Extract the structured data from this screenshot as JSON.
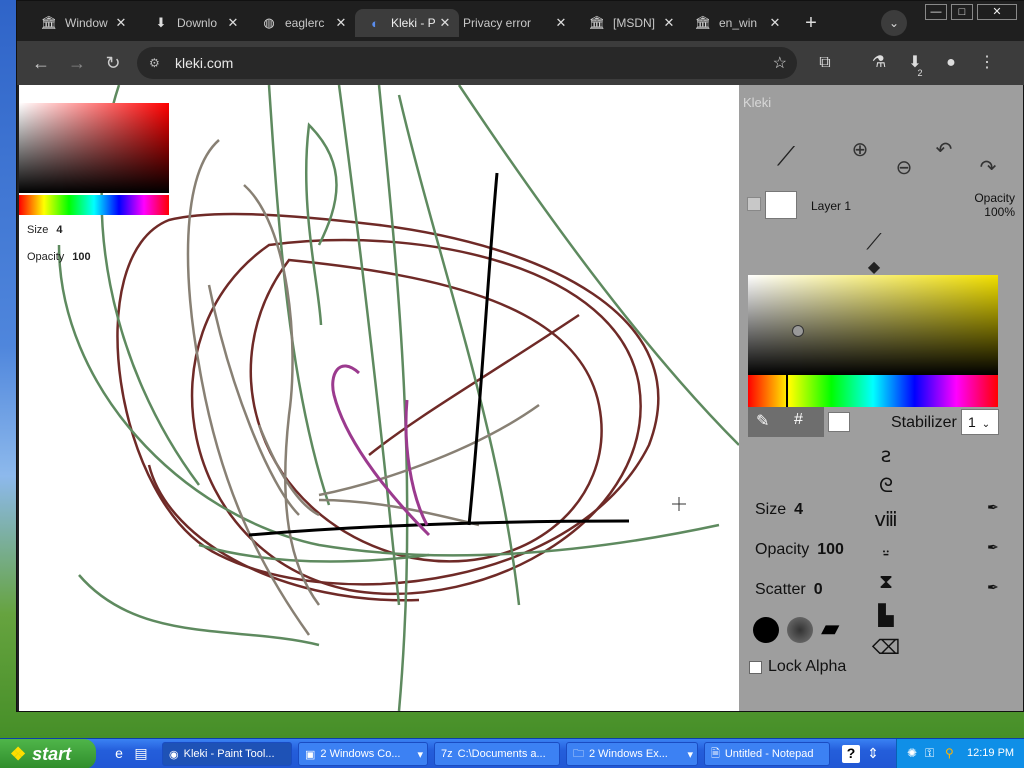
{
  "browser": {
    "tabs": [
      {
        "icon": "bank-icon",
        "glyph": "🏛",
        "label": "Window"
      },
      {
        "icon": "download-icon",
        "glyph": "⬇",
        "label": "Downlo"
      },
      {
        "icon": "globe-icon",
        "glyph": "◍",
        "label": "eaglerc"
      },
      {
        "icon": "kleki-icon",
        "glyph": "◐",
        "label": "Kleki - P"
      },
      {
        "icon": "",
        "glyph": "",
        "label": "Privacy error"
      },
      {
        "icon": "bank-icon",
        "glyph": "🏛",
        "label": "[MSDN]"
      },
      {
        "icon": "bank-icon",
        "glyph": "🏛",
        "label": "en_win"
      }
    ],
    "new_tab": "+",
    "url": "kleki.com",
    "extensions_badge": "2"
  },
  "kleki": {
    "canvas_overlay": {
      "size_label": "Size",
      "size_value": "4",
      "opacity_label": "Opacity",
      "opacity_value": "100"
    },
    "logo": "Kleki",
    "layer": {
      "name": "Layer 1",
      "opacity_label": "Opacity",
      "opacity_value": "100%"
    },
    "stabilizer_label": "Stabilizer",
    "stabilizer_value": "1",
    "hex_button": "#",
    "size_label": "Size",
    "size_value": "4",
    "opacity_label": "Opacity",
    "opacity_value": "100",
    "scatter_label": "Scatter",
    "scatter_value": "0",
    "lock_alpha_label": "Lock Alpha",
    "colors": {
      "primary": "#000000",
      "secondary": "#ffffff",
      "picker_hue": "#f2e000"
    }
  },
  "taskbar": {
    "start_label": "start",
    "tasks": [
      {
        "label": "Kleki - Paint Tool...",
        "icon": "chrome-icon",
        "glyph": "◉"
      },
      {
        "label": "2 Windows Co...",
        "icon": "console-icon",
        "glyph": "▣"
      },
      {
        "label": "C:\\Documents a...",
        "icon": "7zip-icon",
        "glyph": "7z"
      },
      {
        "label": "2 Windows Ex...",
        "icon": "folder-icon",
        "glyph": "🗀"
      },
      {
        "label": "Untitled - Notepad",
        "icon": "notepad-icon",
        "glyph": "🗎"
      }
    ],
    "clock": "12:19 PM"
  }
}
